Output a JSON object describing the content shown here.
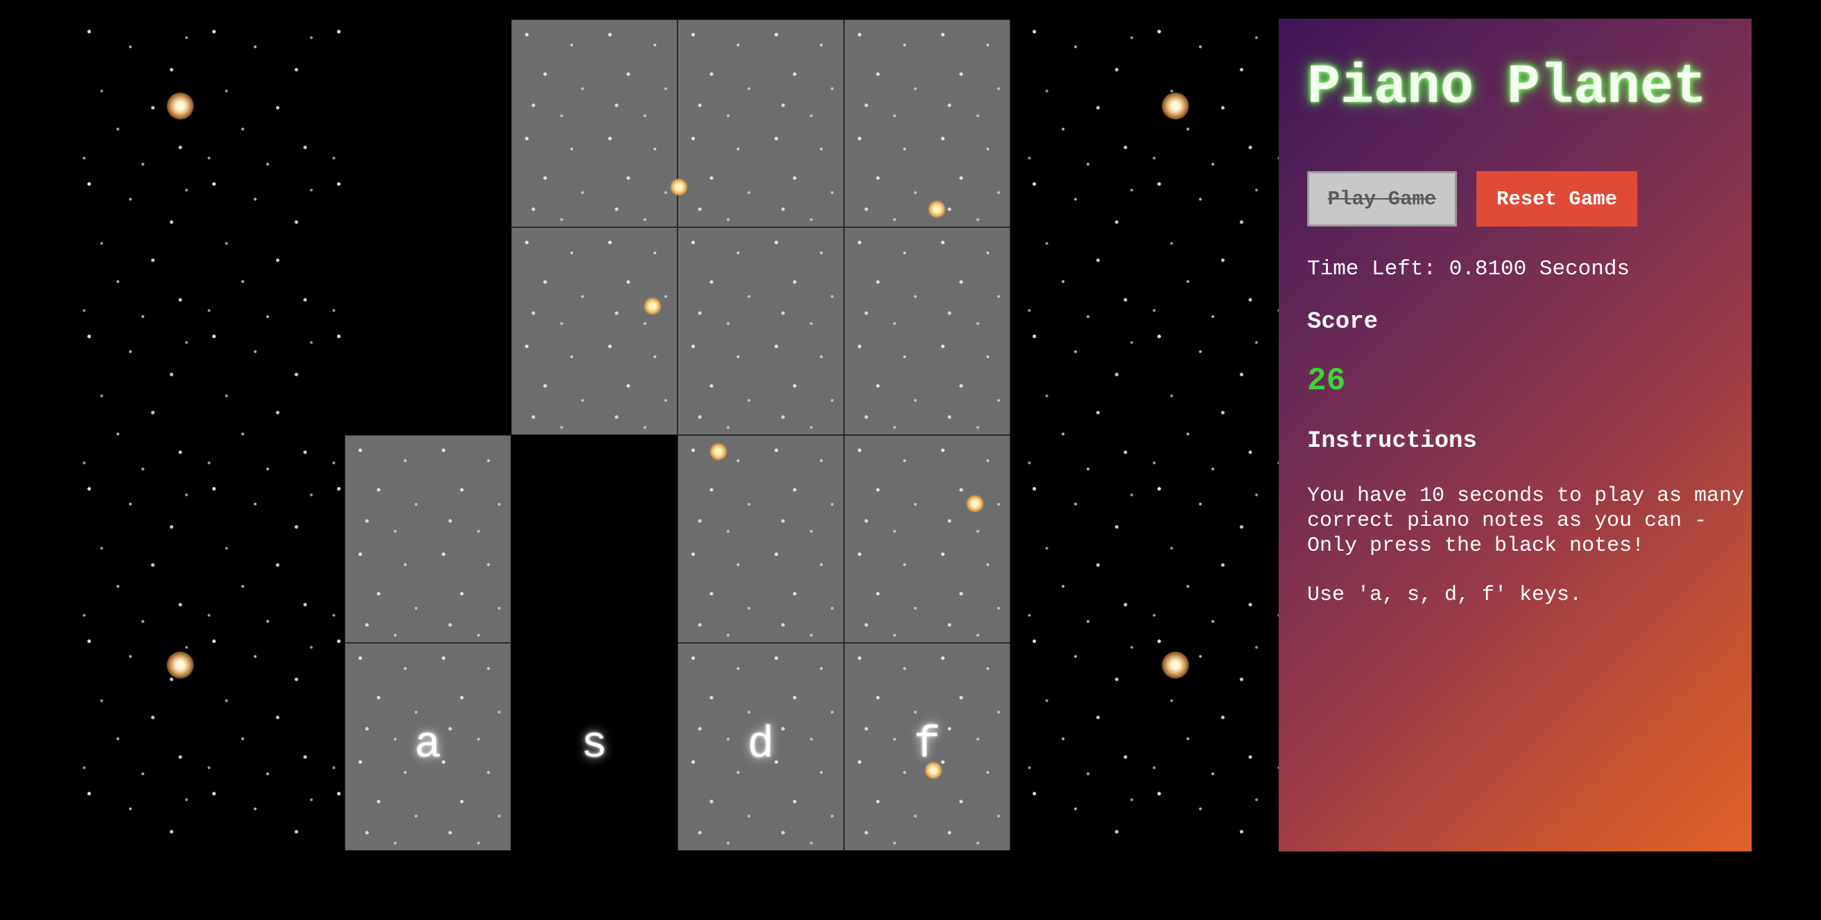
{
  "game": {
    "title": "Piano Planet",
    "play_button": "Play Game",
    "reset_button": "Reset Game",
    "time_left": "Time Left: 0.8100 Seconds",
    "score_label": "Score",
    "score_value": "26",
    "instructions_label": "Instructions",
    "instructions_text": "You have 10 seconds to play as many correct piano notes as you can - Only press the black notes!",
    "keys_text": "Use 'a, s, d, f' keys."
  },
  "board": {
    "columns": 4,
    "rows": 4,
    "key_letters": [
      "a",
      "s",
      "d",
      "f"
    ],
    "black_tiles": [
      {
        "row": 1,
        "col": 1
      },
      {
        "row": 2,
        "col": 1
      },
      {
        "row": 3,
        "col": 2
      },
      {
        "row": 4,
        "col": 2
      }
    ]
  },
  "colors": {
    "tile": "#6e6e6e",
    "black_tile": "#000000",
    "title_glow": "#4ad33a",
    "score": "#3fd43a",
    "reset_button": "#e04a36",
    "play_button": "#c8c8c8",
    "panel_gradient_start": "#3d1558",
    "panel_gradient_end": "#e0622a"
  }
}
